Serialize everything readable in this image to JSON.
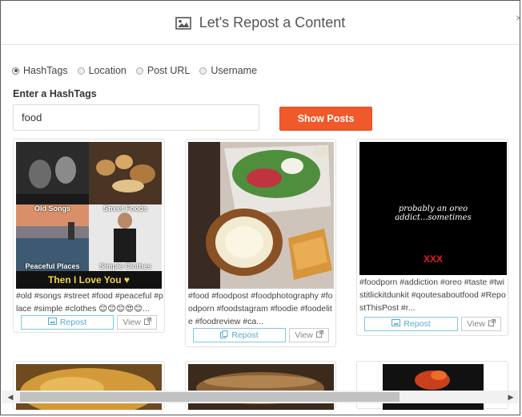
{
  "header": {
    "title": "Let's Repost a Content"
  },
  "search_type": {
    "options": [
      "HashTags",
      "Location",
      "Post URL",
      "Username"
    ],
    "selected_index": 0
  },
  "form": {
    "label": "Enter a HashTags",
    "value": "food",
    "show_button": "Show Posts"
  },
  "cards": [
    {
      "collage": {
        "labels": [
          "Old Songs",
          "Street Foods",
          "Peaceful Places",
          "Simple Clothes"
        ],
        "banner": "Then I Love You ♥"
      },
      "caption": "#old #songs #street #food #peaceful #place #simple #clothes 😊😊😊😍😊...",
      "repost": "Repost",
      "view": "View"
    },
    {
      "caption": "#food #foodpost #foodphotography #foodporn #foodstagram #foodie #foodelite #foodreview #ca...",
      "repost": "Repost",
      "view": "View"
    },
    {
      "image_text": "probably an oreo addict...sometimes",
      "stamp": "XXX",
      "caption": "#foodporn #addiction #oreo #taste #twistitlickitdunkit #qoutesaboutfood #RepostThisPost #r...",
      "repost": "Repost",
      "view": "View"
    }
  ],
  "colors": {
    "accent": "#f05a2b",
    "repost": "#5aa9d6"
  },
  "icons": {
    "header": "image-icon",
    "repost": "image-icon",
    "view": "external-link-icon"
  }
}
